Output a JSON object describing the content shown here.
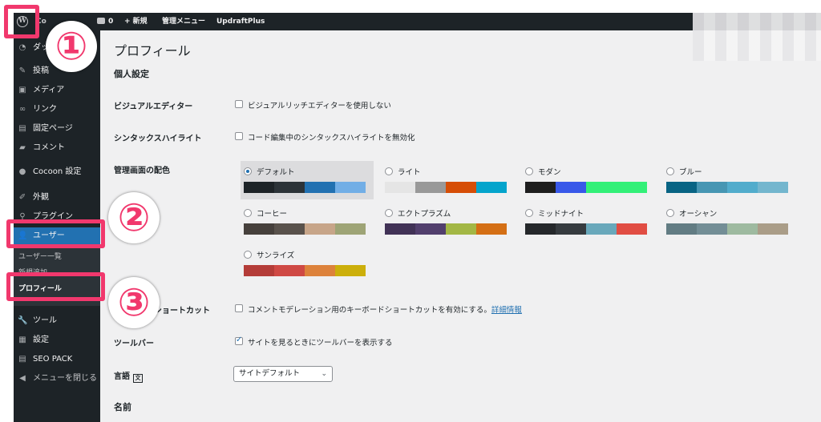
{
  "adminbar": {
    "wp_logo": "W",
    "site": "Co",
    "comments_count": "0",
    "new_label": "+ 新規",
    "admin_menu": "管理メニュー",
    "updraft": "UpdraftPlus"
  },
  "sidebar": {
    "items": [
      {
        "label": "ダッシュボード",
        "icon": "dashboard-icon"
      },
      {
        "label": "投稿",
        "icon": "pin-icon"
      },
      {
        "label": "メディア",
        "icon": "media-icon"
      },
      {
        "label": "リンク",
        "icon": "link-icon"
      },
      {
        "label": "固定ページ",
        "icon": "page-icon"
      },
      {
        "label": "コメント",
        "icon": "comment-icon"
      },
      {
        "label": "Cocoon 設定",
        "icon": "circle-icon"
      },
      {
        "label": "外観",
        "icon": "brush-icon"
      },
      {
        "label": "プラグイン",
        "icon": "plugin-icon"
      },
      {
        "label": "ユーザー",
        "icon": "user-icon"
      },
      {
        "label": "ツール",
        "icon": "wrench-icon"
      },
      {
        "label": "設定",
        "icon": "settings-icon"
      },
      {
        "label": "SEO PACK",
        "icon": "seo-icon"
      },
      {
        "label": "メニューを閉じる",
        "icon": "collapse-icon"
      }
    ],
    "submenu": [
      "ユーザー一覧",
      "新規追加",
      "プロフィール"
    ]
  },
  "main": {
    "title": "プロフィール",
    "section_personal": "個人設定",
    "visual_editor_label": "ビジュアルエディター",
    "visual_editor_option": "ビジュアルリッチエディターを使用しない",
    "syntax_label": "シンタックスハイライト",
    "syntax_option": "コード編集中のシンタックスハイライトを無効化",
    "color_label": "管理画面の配色",
    "schemes": [
      {
        "name": "デフォルト",
        "selected": true,
        "colors": [
          "#1d2327",
          "#2c3338",
          "#2271b1",
          "#72aee6"
        ]
      },
      {
        "name": "ライト",
        "selected": false,
        "colors": [
          "#e5e5e5",
          "#999999",
          "#d64e07",
          "#04a4cc"
        ]
      },
      {
        "name": "モダン",
        "selected": false,
        "colors": [
          "#1e1e1e",
          "#3858e9",
          "#33f078",
          "#33f078"
        ]
      },
      {
        "name": "ブルー",
        "selected": false,
        "colors": [
          "#096484",
          "#4796b3",
          "#52accc",
          "#74b6ce"
        ]
      },
      {
        "name": "コーヒー",
        "selected": false,
        "colors": [
          "#46403c",
          "#59524c",
          "#c7a589",
          "#9ea476"
        ]
      },
      {
        "name": "エクトプラズム",
        "selected": false,
        "colors": [
          "#413256",
          "#523f6d",
          "#a3b745",
          "#d46f15"
        ]
      },
      {
        "name": "ミッドナイト",
        "selected": false,
        "colors": [
          "#25282b",
          "#363b3f",
          "#69a8bb",
          "#e14d43"
        ]
      },
      {
        "name": "オーシャン",
        "selected": false,
        "colors": [
          "#627c83",
          "#738e96",
          "#9ebaa0",
          "#aa9d88"
        ]
      },
      {
        "name": "サンライズ",
        "selected": false,
        "colors": [
          "#b43c38",
          "#cf4944",
          "#dd823b",
          "#ccaf0b"
        ]
      }
    ],
    "shortcut_label": "キーボードショートカット",
    "shortcut_option": "コメントモデレーション用のキーボードショートカットを有効にする。",
    "shortcut_link": "詳細情報",
    "toolbar_label": "ツールバー",
    "toolbar_option": "サイトを見るときにツールバーを表示する",
    "language_label": "言語",
    "language_value": "サイトデフォルト",
    "section_name": "名前"
  },
  "annotations": {
    "badge1": "①",
    "badge2": "②",
    "badge3": "③",
    "accent": "#f1386d"
  }
}
